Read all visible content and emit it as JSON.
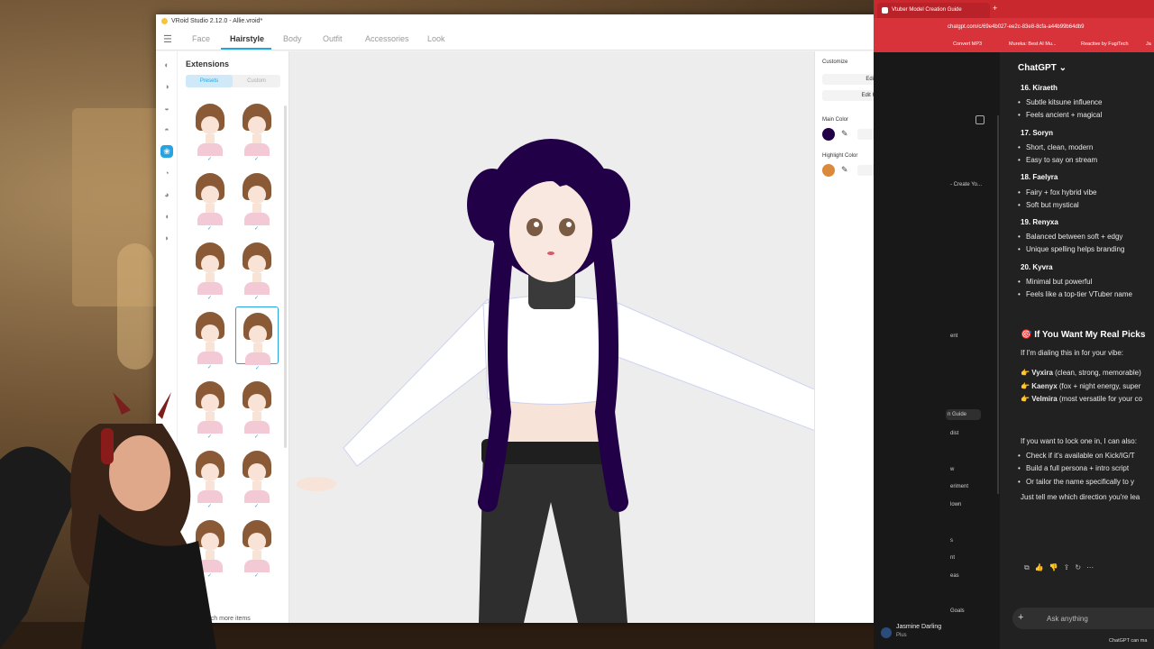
{
  "vroid": {
    "title": "VRoid Studio 2.12.0 - Allie.vroid*",
    "tabs": [
      "Face",
      "Hairstyle",
      "Body",
      "Outfit",
      "Accessories",
      "Look"
    ],
    "active_tab": "Hairstyle",
    "extensions": {
      "title": "Extensions",
      "presets_label": "Presets",
      "custom_label": "Custom",
      "search_more": "Search more items",
      "thumbnail_count": 14,
      "selected_index": 7
    },
    "customize": {
      "title": "Customize",
      "edit_hairstyle": "Edit Hairstyle",
      "edit_hair_bounce": "Edit Hair Bounce",
      "main_color_label": "Main Color",
      "main_color_hex": "#210047",
      "main_color": "#210047",
      "highlight_color_label": "Highlight Color",
      "highlight_color_hex": "#DB8A3B",
      "highlight_color": "#DB8A3B"
    },
    "accent": "#26a4e0"
  },
  "browser": {
    "tab_title": "Vtuber Model Creation Guide",
    "new_tab": "+",
    "url": "chatgpt.com/c/69e4b027-ee2c-83e8-8cfa-a44b99b64db9",
    "bookmarks": [
      "Convert MP3",
      "Mureka: Best AI Mu...",
      "Reactive by FugiTech",
      "Ja"
    ],
    "sidebar_items": [
      " - Create Yo...",
      "ent",
      "n Guide",
      "dist",
      "w",
      "eriment",
      "lown",
      "s",
      "nt",
      "eas",
      "Goals"
    ],
    "user_name": "Jasmine Darling",
    "user_plan": "Plus"
  },
  "chat": {
    "title": "ChatGPT",
    "entries": [
      {
        "heading": "16. Kiraeth",
        "points": [
          "Subtle kitsune influence",
          "Feels ancient + magical"
        ]
      },
      {
        "heading": "17. Soryn",
        "points": [
          "Short, clean, modern",
          "Easy to say on stream"
        ]
      },
      {
        "heading": "18. Faelyra",
        "points": [
          "Fairy + fox hybrid vibe",
          "Soft but mystical"
        ]
      },
      {
        "heading": "19. Renyxa",
        "points": [
          "Balanced between soft + edgy",
          "Unique spelling helps branding"
        ]
      },
      {
        "heading": "20. Kyvra",
        "points": [
          "Minimal but powerful",
          "Feels like a top-tier VTuber name"
        ]
      }
    ],
    "picks_heading": "🎯 If You Want My Real Picks",
    "picks_intro": "If I'm dialing this in for your vibe:",
    "picks": [
      {
        "name": "Vyxira",
        "note": " (clean, strong, memorable)"
      },
      {
        "name": "Kaenyx",
        "note": " (fox + night energy, super"
      },
      {
        "name": "Velmira",
        "note": " (most versatile for your co"
      }
    ],
    "lock_intro": "If you want to lock one in, I can also:",
    "lock_points": [
      "Check if it's available on Kick/IG/T",
      "Build a full persona + intro script",
      "Or tailor the name specifically to y"
    ],
    "closing": "Just tell me which direction you're lea",
    "ask_placeholder": "Ask anything",
    "disclaimer": "ChatGPT can ma"
  }
}
